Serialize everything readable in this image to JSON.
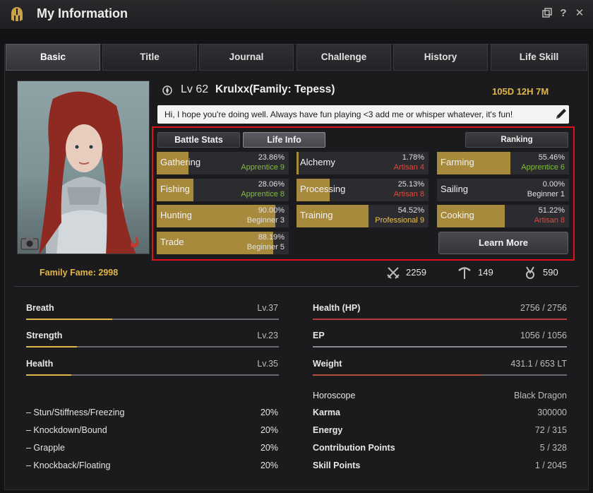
{
  "window": {
    "title": "My Information"
  },
  "tabs": [
    "Basic",
    "Title",
    "Journal",
    "Challenge",
    "History",
    "Life Skill"
  ],
  "profile": {
    "level": "Lv 62",
    "family_name": "Krulxx(Family: Tepess)",
    "playtime": "105D 12H 7M",
    "bio": "Hi, I hope you're doing well. Always have fun playing <3 add me or whisper whatever, it's fun!"
  },
  "life_info": {
    "tabs": [
      "Battle Stats",
      "Life Info"
    ],
    "ranking_label": "Ranking",
    "learn_more_label": "Learn More",
    "skills": [
      {
        "name": "Gathering",
        "percent": "23.86%",
        "rank": "Apprentice 9",
        "fill": 0.2386,
        "rank_color": "#7fbf3b"
      },
      {
        "name": "Alchemy",
        "percent": "1.78%",
        "rank": "Artisan 4",
        "fill": 0.0178,
        "rank_color": "#e0473f"
      },
      {
        "name": "Farming",
        "percent": "55.46%",
        "rank": "Apprentice 6",
        "fill": 0.5546,
        "rank_color": "#7fbf3b"
      },
      {
        "name": "Fishing",
        "percent": "28.06%",
        "rank": "Apprentice 8",
        "fill": 0.2806,
        "rank_color": "#7fbf3b"
      },
      {
        "name": "Processing",
        "percent": "25.13%",
        "rank": "Artisan 8",
        "fill": 0.2513,
        "rank_color": "#e0473f"
      },
      {
        "name": "Sailing",
        "percent": "0.00%",
        "rank": "Beginner 1",
        "fill": 0.0,
        "rank_color": "#e0e0e0"
      },
      {
        "name": "Hunting",
        "percent": "90.00%",
        "rank": "Beginner 3",
        "fill": 0.9,
        "rank_color": "#e0e0e0"
      },
      {
        "name": "Training",
        "percent": "54.52%",
        "rank": "Professional 9",
        "fill": 0.5452,
        "rank_color": "#f0c24a"
      },
      {
        "name": "Cooking",
        "percent": "51.22%",
        "rank": "Artisan 8",
        "fill": 0.5122,
        "rank_color": "#e0473f"
      },
      {
        "name": "Trade",
        "percent": "88.19%",
        "rank": "Beginner 5",
        "fill": 0.8819,
        "rank_color": "#e0e0e0"
      }
    ]
  },
  "summary": {
    "family_fame": "Family Fame: 2998",
    "combat_fame": "2259",
    "life_fame": "149",
    "contribution_fame": "590"
  },
  "left_stats": [
    {
      "label": "Breath",
      "value": "Lv.37",
      "fill": 0.34,
      "color": "#e1b644"
    },
    {
      "label": "Strength",
      "value": "Lv.23",
      "fill": 0.2,
      "color": "#e1b644"
    },
    {
      "label": "Health",
      "value": "Lv.35",
      "fill": 0.18,
      "color": "#e1b644"
    }
  ],
  "resistances": [
    {
      "label": "– Stun/Stiffness/Freezing",
      "value": "20%"
    },
    {
      "label": "– Knockdown/Bound",
      "value": "20%"
    },
    {
      "label": "– Grapple",
      "value": "20%"
    },
    {
      "label": "– Knockback/Floating",
      "value": "20%"
    }
  ],
  "right_stats": [
    {
      "label": "Health (HP)",
      "value": "2756 / 2756",
      "fill": 1.0,
      "color": "#b23a3a"
    },
    {
      "label": "EP",
      "value": "1056 / 1056",
      "fill": 1.0,
      "color": "#8a8a8e"
    },
    {
      "label": "Weight",
      "value": "431.1 / 653 LT",
      "fill": 0.66,
      "color": "#b2503a"
    }
  ],
  "details": [
    {
      "label": "Horoscope",
      "value": "Black Dragon"
    },
    {
      "label": "Karma",
      "value": "300000"
    },
    {
      "label": "Energy",
      "value": "72 / 315"
    },
    {
      "label": "Contribution Points",
      "value": "5 / 328"
    },
    {
      "label": "Skill Points",
      "value": "1 / 2045"
    }
  ]
}
